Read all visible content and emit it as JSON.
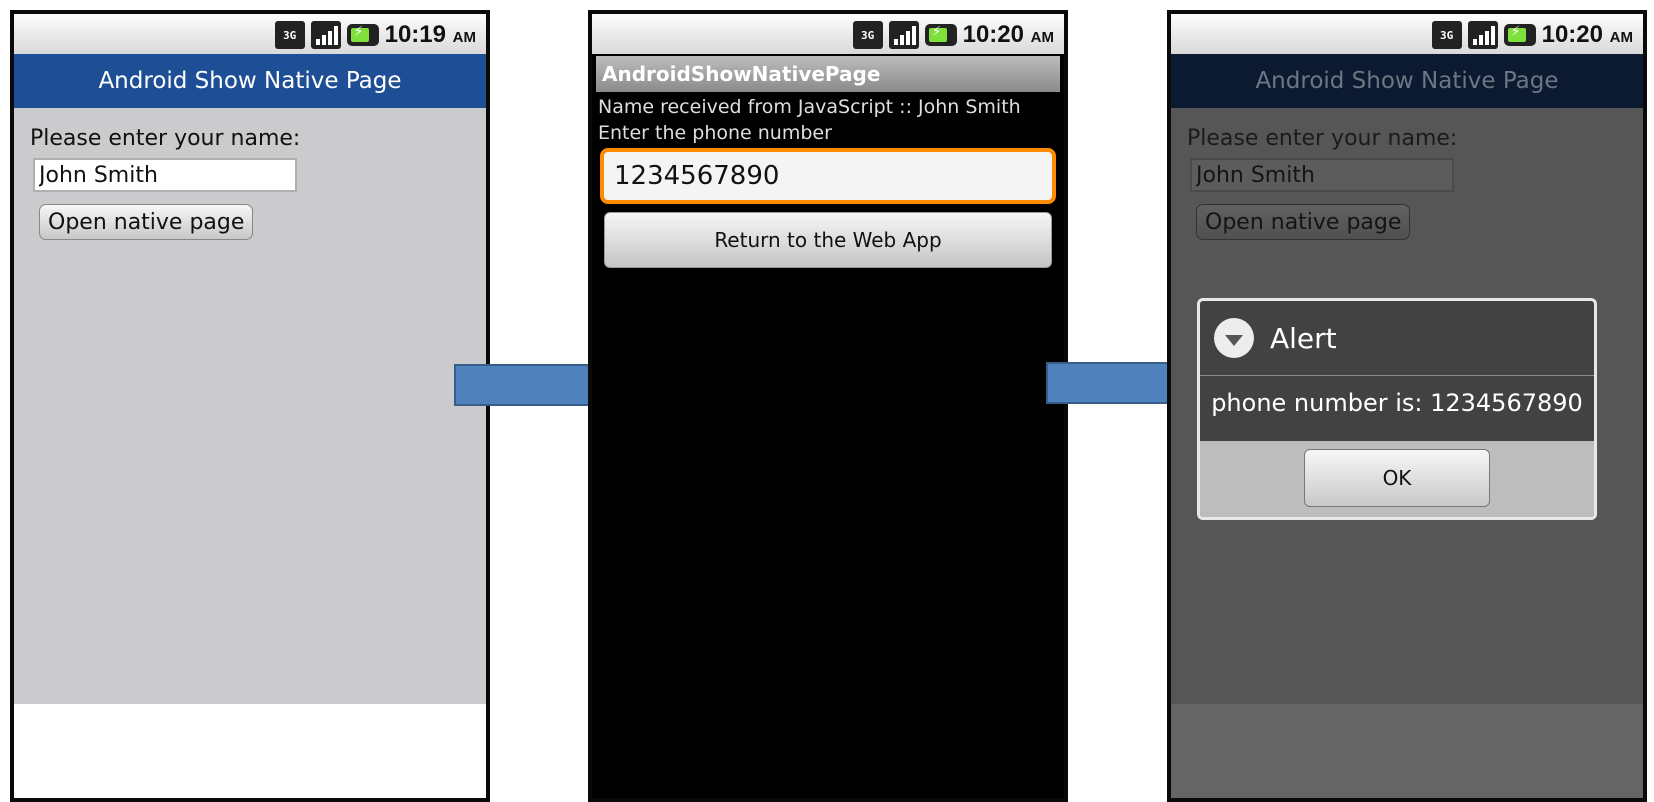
{
  "colors": {
    "title_bar_blue": "#1e4f96",
    "arrow_fill": "#4f81bd",
    "arrow_stroke": "#385d8a",
    "focus_orange": "#ff8c00"
  },
  "status_bar": {
    "icons": [
      "3g-icon",
      "signal-icon",
      "battery-charging-icon"
    ],
    "network_label": "3G"
  },
  "screen1": {
    "time": "10:19",
    "ampm": "AM",
    "title": "Android Show Native Page",
    "prompt": "Please enter your name:",
    "name_value": "John Smith",
    "button_label": "Open native page"
  },
  "screen2": {
    "time": "10:20",
    "ampm": "AM",
    "title": "AndroidShowNativePage",
    "name_received": "Name received from JavaScript :: John Smith",
    "phone_prompt": "Enter the phone number",
    "phone_value": "1234567890",
    "button_label": "Return to the Web App"
  },
  "screen3": {
    "time": "10:20",
    "ampm": "AM",
    "title": "Android Show Native Page",
    "prompt": "Please enter your name:",
    "name_value": "John Smith",
    "button_label": "Open native page",
    "dialog": {
      "title": "Alert",
      "message": "phone number is: 1234567890",
      "ok_label": "OK"
    }
  }
}
